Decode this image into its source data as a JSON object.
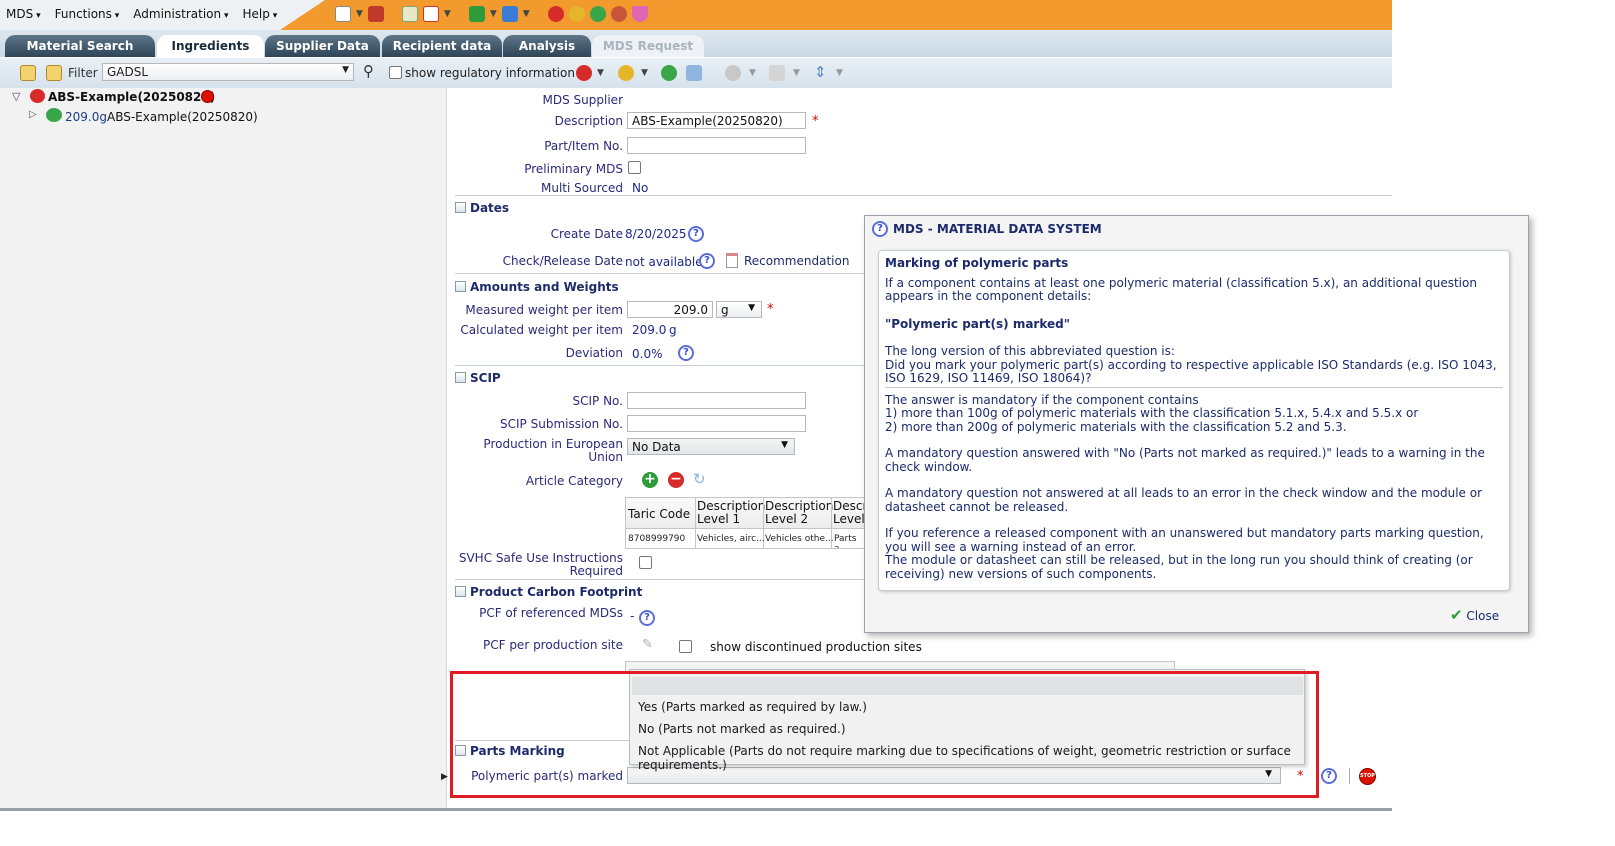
{
  "menu": {
    "items": [
      "MDS",
      "Functions",
      "Administration",
      "Help"
    ]
  },
  "tabs": [
    {
      "label": "Material Search",
      "state": "normal"
    },
    {
      "label": "Ingredients",
      "state": "active"
    },
    {
      "label": "Supplier Data",
      "state": "normal"
    },
    {
      "label": "Recipient data",
      "state": "normal"
    },
    {
      "label": "Analysis",
      "state": "normal"
    },
    {
      "label": "MDS Request",
      "state": "disabled"
    }
  ],
  "filter": {
    "label": "Filter",
    "value": "GADSL",
    "checkbox_label": "show regulatory information"
  },
  "tree": {
    "root_label": "ABS-Example(20250820)",
    "child_weight": "209.0g",
    "child_label": "ABS-Example(20250820)"
  },
  "form": {
    "mds_supplier_label": "MDS Supplier",
    "description_label": "Description",
    "description_value": "ABS-Example(20250820)",
    "part_no_label": "Part/Item No.",
    "preliminary_label": "Preliminary MDS",
    "multi_sourced_label": "Multi Sourced",
    "multi_sourced_value": "No",
    "dates_section": "Dates",
    "create_date_label": "Create Date",
    "create_date_value": "8/20/2025",
    "check_release_label": "Check/Release Date",
    "check_release_value": "not available",
    "recommendation_label": "Recommendation",
    "amounts_section": "Amounts and Weights",
    "measured_label": "Measured weight per item",
    "measured_value": "209.0",
    "measured_unit": "g",
    "calculated_label": "Calculated weight per item",
    "calculated_value": "209.0",
    "calculated_unit": "g",
    "deviation_label": "Deviation",
    "deviation_value": "0.0%",
    "scip_section": "SCIP",
    "scip_no_label": "SCIP No.",
    "scip_sub_label": "SCIP Submission No.",
    "production_eu_label_1": "Production in European",
    "production_eu_label_2": "Union",
    "production_eu_value": "No Data",
    "article_category_label": "Article Category",
    "taric_headers": [
      "Taric Code",
      "Description Level 1",
      "Description Level 2",
      "Descr Level"
    ],
    "taric_row": [
      "8708999790",
      "Vehicles, airc...",
      "Vehicles othe...",
      "Parts a"
    ],
    "svhc_label_1": "SVHC Safe Use Instructions",
    "svhc_label_2": "Required",
    "pcf_section": "Product Carbon Footprint",
    "pcf_ref_label": "PCF of referenced MDSs",
    "pcf_ref_value": "-",
    "pcf_site_label": "PCF per production site",
    "show_discontinued_label": "show discontinued production sites",
    "parts_marking_section": "Parts Marking",
    "polymeric_label": "Polymeric part(s) marked"
  },
  "dropdown": {
    "options": [
      "",
      "Yes (Parts marked as required by law.)",
      "No (Parts not marked as required.)",
      "Not Applicable (Parts do not require marking due to specifications of weight, geometric restriction or surface requirements.)"
    ]
  },
  "dialog": {
    "title": "MDS - MATERIAL DATA SYSTEM",
    "heading": "Marking of polymeric parts",
    "p1": "If a component contains at least one polymeric material (classification 5.x), an additional question appears in the component details:",
    "quote": "\"Polymeric part(s) marked\"",
    "p2a": "The long version of this abbreviated question is:",
    "p2b": "Did you mark your polymeric part(s) according to respective applicable ISO Standards (e.g. ISO 1043, ISO 1629, ISO 11469, ISO 18064)?",
    "p3a": "The answer is mandatory if the component contains",
    "p3b": "1) more than 100g of polymeric materials with the classification 5.1.x, 5.4.x and 5.5.x or",
    "p3c": "2) more than 200g of polymeric materials with the classification 5.2 and 5.3.",
    "p4": "A mandatory question answered with \"No (Parts not marked as required.)\" leads to a warning in the check window.",
    "p5": "A mandatory question not answered at all leads to an error in the check window and the module or datasheet cannot be released.",
    "p6a": "If you reference a released component with an unanswered but mandatory parts marking question, you will see a warning instead of an error.",
    "p6b": "The module or datasheet can still be released, but in the long run you should think of creating (or receiving) new versions of such components.",
    "close_label": "Close"
  },
  "colors": {
    "accent_orange": "#f29a2e",
    "tab_dark": "#2e4457",
    "highlight_red": "#e01b24",
    "link_blue": "#1c2b6b"
  }
}
